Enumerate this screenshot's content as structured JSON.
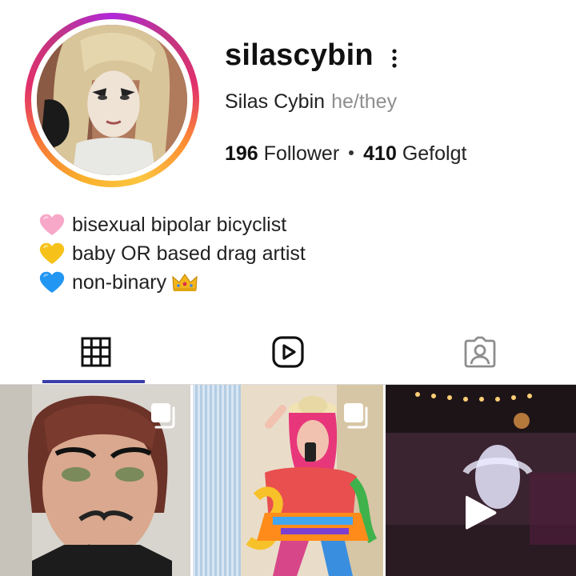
{
  "profile": {
    "username": "silascybin",
    "full_name": "Silas Cybin",
    "pronouns": "he/they",
    "followers_count": "196",
    "followers_label": "Follower",
    "following_count": "410",
    "following_label": "Gefolgt"
  },
  "bio": [
    {
      "emoji": "pink-heart",
      "text": "bisexual bipolar bicyclist"
    },
    {
      "emoji": "yellow-heart",
      "text": "baby OR based drag artist"
    },
    {
      "emoji": "blue-heart",
      "text": "non-binary",
      "trailing_emoji": "crown"
    }
  ],
  "tabs": [
    {
      "name": "posts",
      "icon": "grid-icon",
      "selected": true
    },
    {
      "name": "reels",
      "icon": "reels-icon",
      "selected": false
    },
    {
      "name": "tagged",
      "icon": "tagged-person-icon",
      "selected": false
    }
  ],
  "posts": [
    {
      "type": "carousel",
      "icon": "multiple-photos-icon"
    },
    {
      "type": "carousel",
      "icon": "multiple-photos-icon"
    },
    {
      "type": "video",
      "icon": "play-icon"
    }
  ],
  "colors": {
    "accent_indicator": "#3b3fa8",
    "pink_heart": "#f7a8c8",
    "yellow_heart": "#f6c21a",
    "blue_heart": "#2196f3",
    "secondary_text": "#8e8e8e"
  }
}
